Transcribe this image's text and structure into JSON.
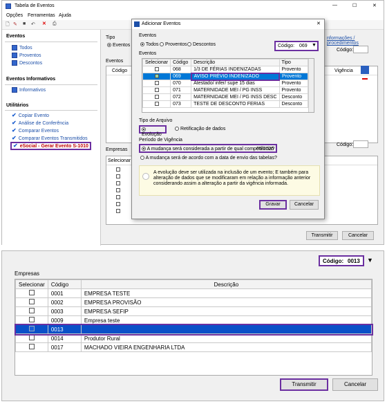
{
  "window": {
    "title": "Tabela de Eventos",
    "controls": {
      "minimize": "—",
      "maximize": "☐",
      "close": "✕"
    }
  },
  "menu": [
    "Opções",
    "Ferramentas",
    "Ajuda"
  ],
  "sidebar": {
    "sections": [
      {
        "title": "Eventos",
        "items": [
          "Todos",
          "Proventos",
          "Descontos"
        ]
      },
      {
        "title": "Eventos Informativos",
        "items": [
          "Informativos"
        ]
      },
      {
        "title": "Utilitários",
        "items": [
          "Copiar Evento",
          "Análise de Conferência",
          "Comparar Eventos",
          "Comparar Eventos Transmitidos",
          "eSocial - Gerar Evento S-1010"
        ]
      }
    ]
  },
  "main": {
    "tipo_label": "Tipo",
    "tipo_value": "Eventos",
    "eventos_label": "Eventos",
    "codigo_col": "Código",
    "vigencia_col": "Vigência",
    "codigo_label": "Código:",
    "link_text": "nformações / procedimentos",
    "empresas_label": "Empresas",
    "selecionar_col": "Selecionar",
    "codigo2_label": "Código:",
    "transmitir": "Transmitir",
    "cancelar": "Cancelar"
  },
  "dialog": {
    "title": "Adicionar Eventos",
    "eventos_group": "Eventos",
    "radios": [
      "Todos",
      "Proventos",
      "Descontos"
    ],
    "codigo_label": "Código:",
    "codigo_value": "069",
    "list_label": "Eventos",
    "columns": [
      "Selecionar",
      "Código",
      "Descrição",
      "Tipo"
    ],
    "rows": [
      {
        "codigo": "068",
        "descricao": "1/3 DE FÉRIAS INDENIZADAS",
        "tipo": "Provento"
      },
      {
        "codigo": "069",
        "descricao": "AVISO PRÉVIO INDENIZADO",
        "tipo": "Provento"
      },
      {
        "codigo": "070",
        "descricao": "Atestado/ infer/ supe 15 dias",
        "tipo": "Provento"
      },
      {
        "codigo": "071",
        "descricao": "MATERNIDADE MEI / PG INSS",
        "tipo": "Provento"
      },
      {
        "codigo": "072",
        "descricao": "MATERNIDADE MEI / PG INSS DESC",
        "tipo": "Desconto"
      },
      {
        "codigo": "073",
        "descricao": "TESTE DE DESCONTO FERIAS",
        "tipo": "Desconto"
      }
    ],
    "tipo_arquivo_label": "Tipo de Arquivo",
    "evolucao": "Evolução",
    "retificacao": "Retificação de dados",
    "periodo_label": "Período de Vigência",
    "opt1": "A mudança será considerada a partir de qual competência?",
    "opt1_value": "05/2025",
    "opt2": "A mudança será de acordo com a data de envio das tabelas?",
    "info": "A evolução deve ser utilizada na inclusão de um evento; E também para alteração de dados que se modificaram em relação a informação anterior considerando assim a alteração a partir da vigência informada.",
    "gravar": "Gravar",
    "cancelar": "Cancelar"
  },
  "zoom": {
    "codigo_label": "Código:",
    "codigo_value": "0013",
    "empresas_label": "Empresas",
    "columns": [
      "Selecionar",
      "Código",
      "Descrição"
    ],
    "rows": [
      {
        "codigo": "0001",
        "descricao": "EMPRESA TESTE"
      },
      {
        "codigo": "0002",
        "descricao": "EMPRESA PROVISÃO"
      },
      {
        "codigo": "0003",
        "descricao": "EMPRESA SEFIP"
      },
      {
        "codigo": "0009",
        "descricao": "Empresa teste"
      },
      {
        "codigo": "0013",
        "descricao": ""
      },
      {
        "codigo": "0014",
        "descricao": "Produtor Rural"
      },
      {
        "codigo": "0017",
        "descricao": "MACHADO VIEIRA ENGENHARIA LTDA"
      }
    ],
    "transmitir": "Transmitir",
    "cancelar": "Cancelar"
  }
}
